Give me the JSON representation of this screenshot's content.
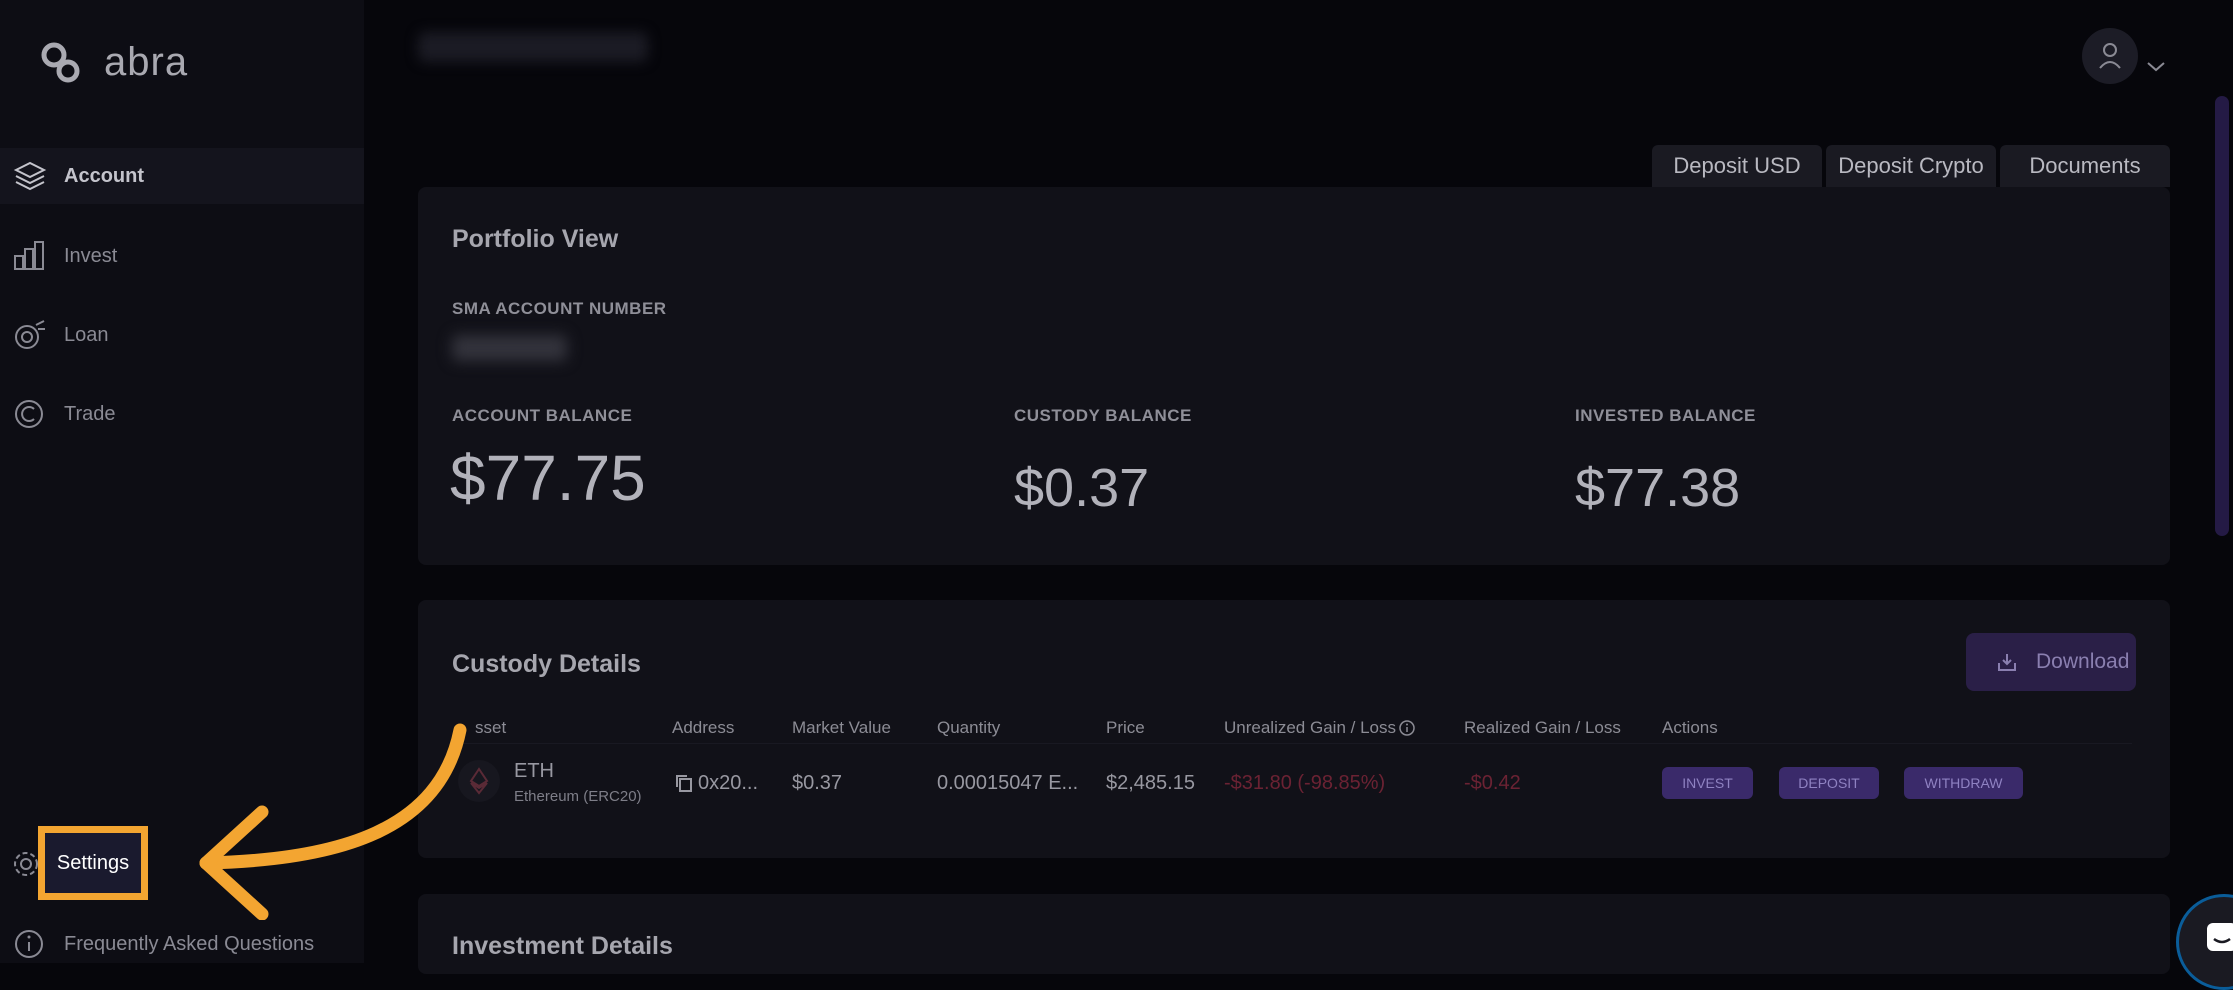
{
  "brand": {
    "name": "abra"
  },
  "sidebar": {
    "items": [
      {
        "label": "Account",
        "icon": "layers-icon",
        "active": true
      },
      {
        "label": "Invest",
        "icon": "bar-chart-icon"
      },
      {
        "label": "Loan",
        "icon": "loan-icon"
      },
      {
        "label": "Trade",
        "icon": "trade-icon"
      }
    ],
    "settings": {
      "label": "Settings",
      "icon": "gear-icon"
    },
    "faq": {
      "label": "Frequently Asked Questions",
      "icon": "info-icon"
    }
  },
  "top_actions": {
    "deposit_usd": "Deposit USD",
    "deposit_crypto": "Deposit Crypto",
    "documents": "Documents"
  },
  "portfolio": {
    "title": "Portfolio View",
    "sma_label": "SMA ACCOUNT NUMBER",
    "account_balance_label": "ACCOUNT BALANCE",
    "account_balance": "$77.75",
    "custody_balance_label": "CUSTODY BALANCE",
    "custody_balance": "$0.37",
    "invested_balance_label": "INVESTED BALANCE",
    "invested_balance": "$77.38"
  },
  "custody": {
    "title": "Custody Details",
    "download_label": "Download",
    "columns": [
      "sset",
      "Address",
      "Market Value",
      "Quantity",
      "Price",
      "Unrealized Gain / Loss",
      "Realized Gain / Loss",
      "Actions"
    ],
    "row": {
      "asset": "ETH",
      "asset_sub": "Ethereum (ERC20)",
      "address": "0x20...",
      "market_value": "$0.37",
      "quantity": "0.00015047 E...",
      "price": "$2,485.15",
      "unrealized": "-$31.80 (-98.85%)",
      "realized": "-$0.42",
      "actions": [
        "INVEST",
        "DEPOSIT",
        "WITHDRAW"
      ]
    }
  },
  "investment": {
    "title": "Investment Details"
  },
  "colors": {
    "accent": "#3a2a6a",
    "highlight": "#f3a531",
    "negative": "#6b2233"
  }
}
